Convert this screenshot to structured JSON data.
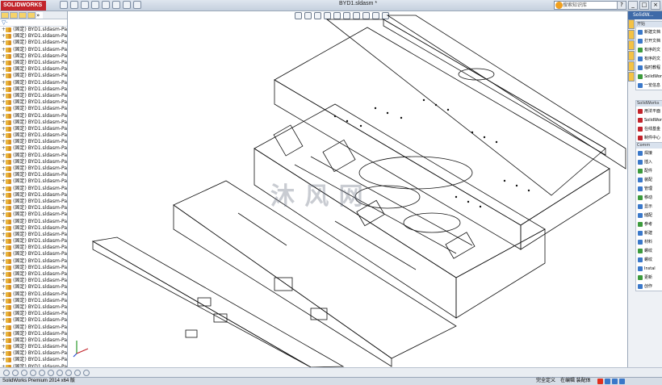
{
  "titlebar": {
    "app_logo": "SOLIDWORKS",
    "document_title": "BYD1.sldasm *",
    "search_placeholder": "搜索知识库"
  },
  "feature_tree": {
    "filter_icon": "filter-icon",
    "rows": [
      "(固定) BYD1.sldasm-Pa",
      "(固定) BYD1.sldasm-Pa",
      "(固定) BYD1.sldasm-Pa",
      "(固定) BYD1.sldasm-Pa",
      "(固定) BYD1.sldasm-Pa",
      "(固定) BYD1.sldasm-Pa",
      "(固定) BYD1.sldasm-Pa",
      "(固定) BYD1.sldasm-Pa",
      "(固定) BYD1.sldasm-Pa",
      "(固定) BYD1.sldasm-Pa",
      "(固定) BYD1.sldasm-Pa",
      "(固定) BYD1.sldasm-Pa",
      "(固定) BYD1.sldasm-Pa",
      "(固定) BYD1.sldasm-Pa",
      "(固定) BYD1.sldasm-Pa",
      "(固定) BYD1.sldasm-Pa",
      "(固定) BYD1.sldasm-Pa",
      "(固定) BYD1.sldasm-Pa",
      "(固定) BYD1.sldasm-Pa",
      "(固定) BYD1.sldasm-Pa",
      "(固定) BYD1.sldasm-Pa",
      "(固定) BYD1.sldasm-Pa",
      "(固定) BYD1.sldasm-Pa",
      "(固定) BYD1.sldasm-Pa",
      "(固定) BYD1.sldasm-Pa",
      "(固定) BYD1.sldasm-Pa",
      "(固定) BYD1.sldasm-Pa",
      "(固定) BYD1.sldasm-Pa",
      "(固定) BYD1.sldasm-Pa",
      "(固定) BYD1.sldasm-Pa",
      "(固定) BYD1.sldasm-Pa",
      "(固定) BYD1.sldasm-Pa",
      "(固定) BYD1.sldasm-Pa",
      "(固定) BYD1.sldasm-Pa",
      "(固定) BYD1.sldasm-Pa",
      "(固定) BYD1.sldasm-Pa",
      "(固定) BYD1.sldasm-Pa",
      "(固定) BYD1.sldasm-Pa",
      "(固定) BYD1.sldasm-Pa",
      "(固定) BYD1.sldasm-Pa",
      "(固定) BYD1.sldasm-Pa",
      "(固定) BYD1.sldasm-Pa",
      "(固定) BYD1.sldasm-Pa",
      "(固定) BYD1.sldasm-Pa",
      "(固定) BYD1.sldasm-Pa",
      "(固定) BYD1.sldasm-Pa",
      "(固定) BYD1.sldasm-Pa",
      "(固定) BYD1.sldasm-Pa",
      "(固定) BYD1.sldasm-Pa",
      "(固定) BYD1.sldasm-Pa",
      "(固定) BYD1.sldasm-Pa",
      "(固定) BYD1.sldasm-Pa"
    ]
  },
  "graphics": {
    "watermark": "沐 风 网"
  },
  "task_pane": {
    "header": "SolidW...",
    "sections": [
      {
        "title": "开始",
        "items": [
          "新建文档",
          "打开文档",
          "有序的文",
          "有序的文",
          "临时教程",
          "SolidWor",
          "一览信息"
        ]
      },
      {
        "title": "SolidWorks",
        "items": [
          "用法平面",
          "SolidWor",
          "在线基金",
          "制件中心"
        ]
      },
      {
        "title": "Comm",
        "items": [
          "焊接",
          "插入",
          "配件",
          "装配",
          "管理",
          "移动",
          "显示",
          "储配",
          "参考",
          "新建",
          "材料",
          "螺纹",
          "螺纹",
          "Instal",
          "更新",
          "创作"
        ]
      }
    ]
  },
  "statusbar": {
    "app_version": "SolidWorks Premium 2014 x64 版",
    "fully_defined": "完全定义",
    "editing": "在编辑 装配体"
  },
  "colors": {
    "brand_red": "#c2242b",
    "task_header": "#3e6aa8"
  }
}
